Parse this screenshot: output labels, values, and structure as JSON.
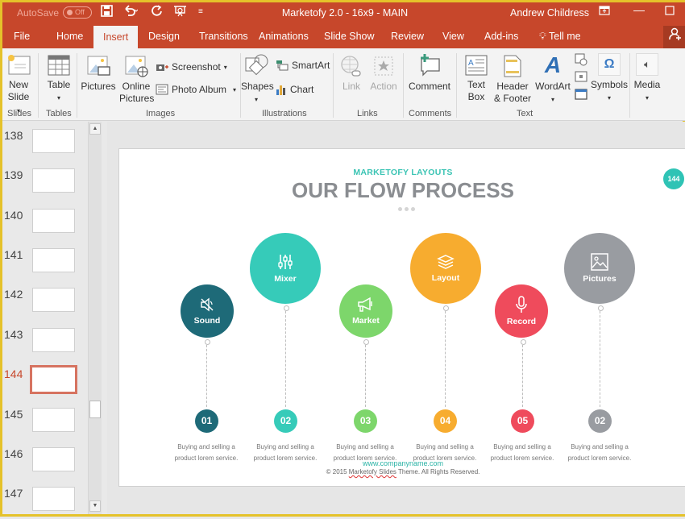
{
  "titlebar": {
    "autosave_label": "AutoSave",
    "autosave_state": "Off",
    "title": "Marketofy 2.0 - 16x9 - MAIN",
    "user": "Andrew Childress",
    "qat_icons": [
      "save-icon",
      "undo-icon",
      "redo-icon",
      "present-icon",
      "customize-icon"
    ],
    "window_controls": [
      "ribbon-display-icon",
      "minimize-icon",
      "maximize-icon"
    ]
  },
  "tabs": {
    "items": [
      "File",
      "Home",
      "Insert",
      "Design",
      "Transitions",
      "Animations",
      "Slide Show",
      "Review",
      "View",
      "Add-ins"
    ],
    "active": "Insert",
    "tell_me": "Tell me"
  },
  "ribbon": {
    "groups": {
      "slides": "Slides",
      "tables": "Tables",
      "images": "Images",
      "illustrations": "Illustrations",
      "links": "Links",
      "comments": "Comments",
      "text": "Text"
    },
    "buttons": {
      "new_slide_1": "New",
      "new_slide_2": "Slide",
      "table": "Table",
      "pictures": "Pictures",
      "online_pictures_1": "Online",
      "online_pictures_2": "Pictures",
      "screenshot": "Screenshot",
      "photo_album": "Photo Album",
      "shapes": "Shapes",
      "smartart": "SmartArt",
      "chart": "Chart",
      "link": "Link",
      "action": "Action",
      "comment": "Comment",
      "text_box_1": "Text",
      "text_box_2": "Box",
      "header_footer_1": "Header",
      "header_footer_2": "& Footer",
      "wordart": "WordArt",
      "symbols": "Symbols",
      "media": "Media"
    }
  },
  "thumbnails": {
    "items": [
      {
        "num": "138"
      },
      {
        "num": "139"
      },
      {
        "num": "140"
      },
      {
        "num": "141"
      },
      {
        "num": "142"
      },
      {
        "num": "143"
      },
      {
        "num": "144",
        "active": true
      },
      {
        "num": "145"
      },
      {
        "num": "146"
      },
      {
        "num": "147"
      }
    ]
  },
  "slide": {
    "subtitle": "MARKETOFY LAYOUTS",
    "title": "OUR FLOW PROCESS",
    "badge": "144",
    "steps": [
      {
        "label": "Sound",
        "icon": "speaker-icon",
        "num": "01",
        "color": "#1e6a78",
        "desc1": "Buying and selling a",
        "desc2": "product lorem service."
      },
      {
        "label": "Mixer",
        "icon": "sliders-icon",
        "num": "02",
        "color": "#36cbb9",
        "desc1": "Buying and selling a",
        "desc2": "product lorem service."
      },
      {
        "label": "Market",
        "icon": "megaphone-icon",
        "num": "03",
        "color": "#7dd66b",
        "desc1": "Buying and selling a",
        "desc2": "product lorem service."
      },
      {
        "label": "Layout",
        "icon": "layers-icon",
        "num": "04",
        "color": "#f7ac2f",
        "desc1": "Buying and selling a",
        "desc2": "product lorem service."
      },
      {
        "label": "Record",
        "icon": "microphone-icon",
        "num": "05",
        "color": "#ef4b5c",
        "desc1": "Buying and selling a",
        "desc2": "product lorem service."
      },
      {
        "label": "Pictures",
        "icon": "image-icon",
        "num": "02",
        "color": "#999ca1",
        "desc1": "Buying and selling a",
        "desc2": "product lorem service."
      }
    ],
    "footer_url": "www.companyname.com",
    "footer_copy_pre": "© 2015 ",
    "footer_copy_brand": "Marketofy Slides",
    "footer_copy_post": " Theme. All Rights Reserved."
  },
  "colors": {
    "accent": "#c7472b",
    "teal": "#3bc4b4"
  }
}
